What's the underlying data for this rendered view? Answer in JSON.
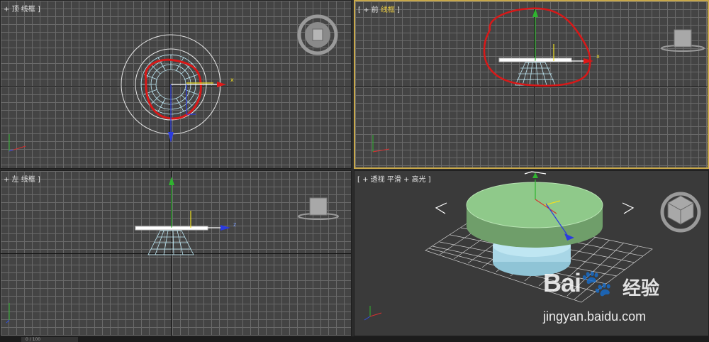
{
  "viewports": {
    "top": {
      "label_prefix": "+ ",
      "label_view": "顶",
      "label_mode": "线框",
      "bracket_open": "[",
      "bracket_close": "]"
    },
    "front": {
      "label_prefix": "[ + ",
      "label_view": "前",
      "label_mode": "线框",
      "label_suffix": " ]"
    },
    "left": {
      "label_prefix": "+ ",
      "label_view": "左",
      "label_mode": "线框",
      "bracket_close": "]"
    },
    "perspective": {
      "label_prefix": "[ + ",
      "label_view": "透视",
      "label_mode": "平滑 + 高光",
      "label_suffix": " ]"
    }
  },
  "gizmo": {
    "x_label": "x",
    "z_label": "z"
  },
  "timeline": {
    "text": "0 / 100"
  },
  "watermark": {
    "logo": "Bai🐾",
    "brand_cn": "经验",
    "url": "jingyan.baidu.com"
  },
  "colors": {
    "viewport_bg": "#444444",
    "grid": "#6a6a6a",
    "active_border": "#c8a84a",
    "annotation_red": "#d81818",
    "wireframe": "#bfe9f5",
    "table_top": "#8fc98a"
  }
}
